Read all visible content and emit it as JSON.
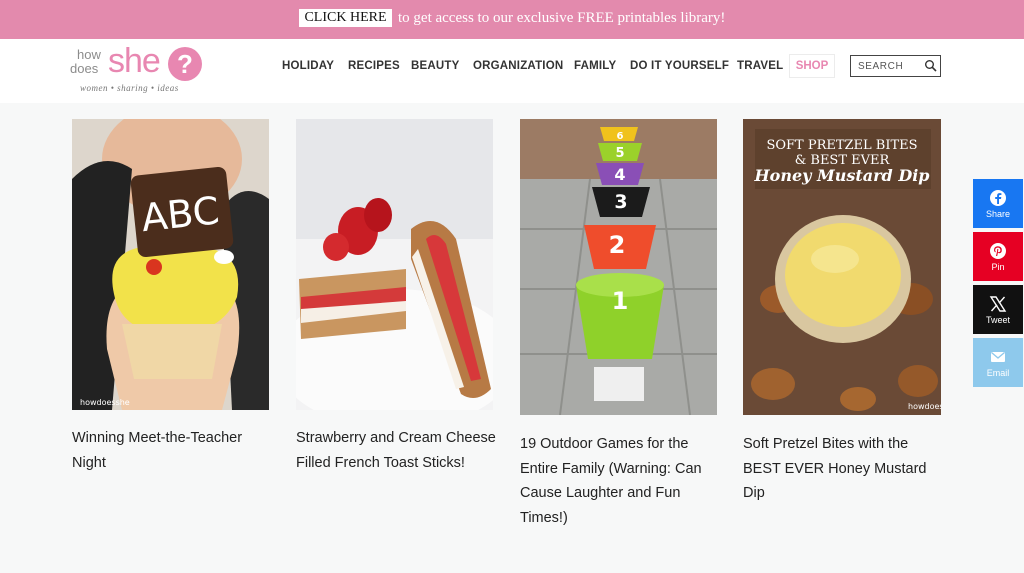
{
  "promo": {
    "button_label": "CLICK HERE",
    "text": "to get access to our exclusive FREE printables library!"
  },
  "logo": {
    "how": "how",
    "does": "does",
    "she": "she",
    "question_mark": "?",
    "tagline": "women • sharing • ideas"
  },
  "nav": {
    "items": [
      "HOLIDAY",
      "RECIPES",
      "BEAUTY",
      "ORGANIZATION",
      "FAMILY",
      "DO IT YOURSELF",
      "TRAVEL"
    ],
    "shop": "SHOP"
  },
  "search": {
    "placeholder": "SEARCH"
  },
  "posts": [
    {
      "title": "Winning Meet-the-Teacher Night",
      "image_text": "ABC",
      "watermark": "howdoesshe"
    },
    {
      "title": "Strawberry and Cream Cheese Filled French Toast Sticks!"
    },
    {
      "title": "19 Outdoor Games for the Entire Family (Warning: Can Cause Laughter and Fun Times!)",
      "image_numbers": [
        "6",
        "5",
        "4",
        "3",
        "2",
        "1"
      ]
    },
    {
      "title": "Soft Pretzel Bites with the BEST EVER Honey Mustard Dip",
      "image_caption_line1": "SOFT PRETZEL BITES",
      "image_caption_line2": "& BEST EVER",
      "image_caption_line3": "Honey Mustard Dip",
      "watermark": "howdoesshe"
    }
  ],
  "social": [
    {
      "label": "Share",
      "icon": "facebook-icon",
      "color": "#1877f2"
    },
    {
      "label": "Pin",
      "icon": "pinterest-icon",
      "color": "#e60023"
    },
    {
      "label": "Tweet",
      "icon": "x-icon",
      "color": "#111111"
    },
    {
      "label": "Email",
      "icon": "email-icon",
      "color": "#8ec9ec"
    }
  ],
  "colors": {
    "brand_pink": "#e887b1",
    "promo_bar": "#e38aad",
    "page_bg": "#f7f8f8"
  }
}
